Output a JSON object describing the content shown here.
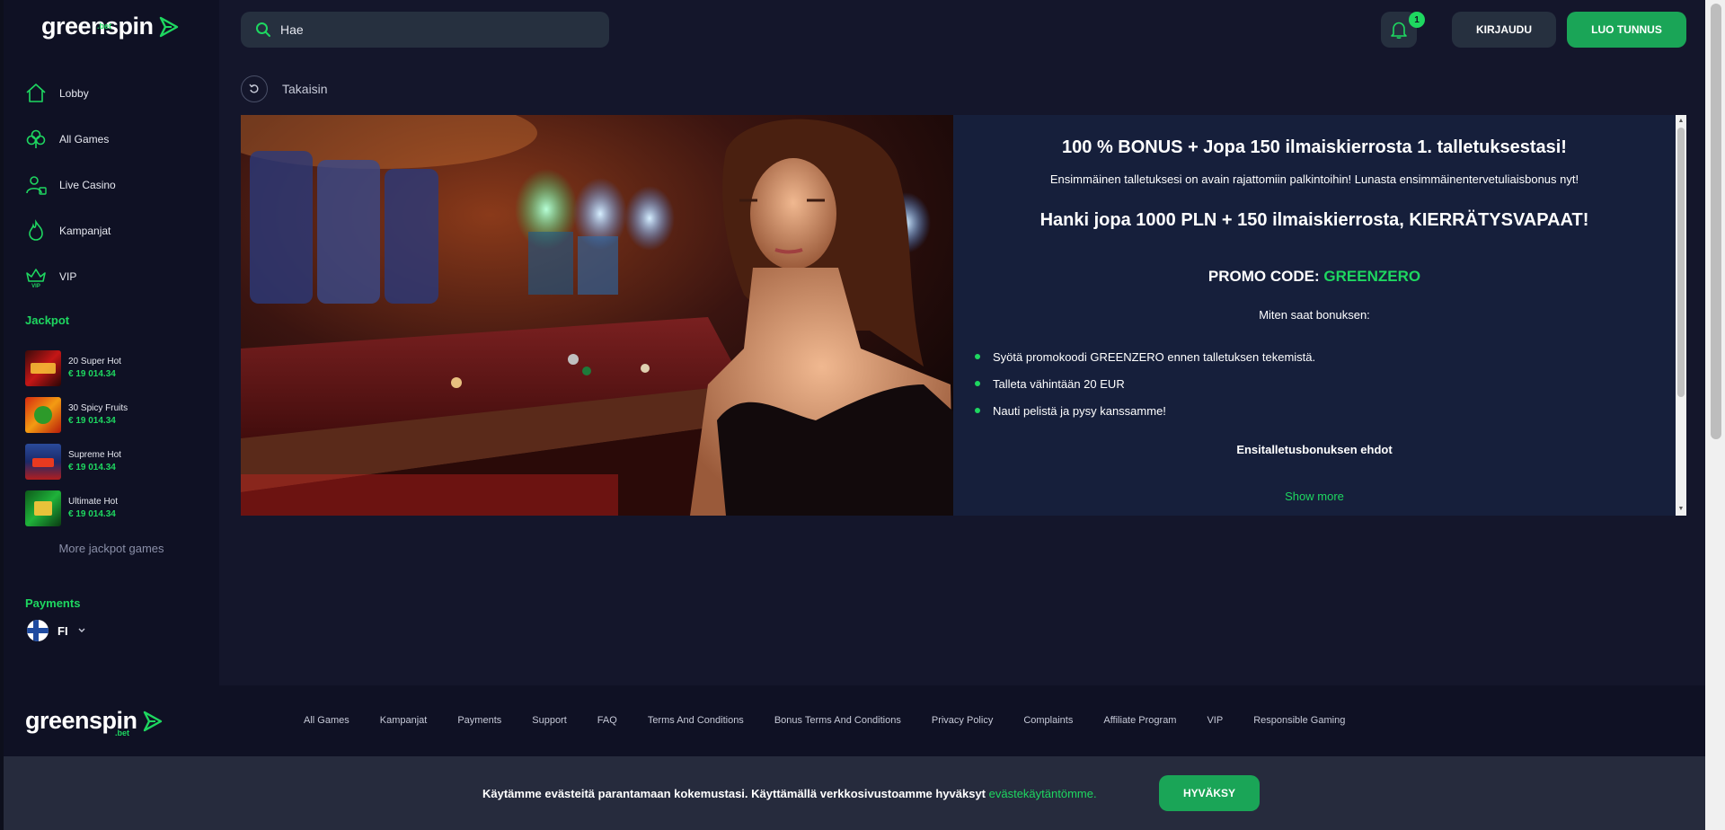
{
  "brand": {
    "name": "greenspin",
    "tld": ".bet",
    "accent": "#1ed760",
    "button_green": "#1aa557"
  },
  "header": {
    "search_placeholder": "Hae",
    "notification_count": "1",
    "login_label": "KIRJAUDU",
    "register_label": "LUO TUNNUS"
  },
  "sidebar": {
    "items": [
      {
        "label": "Lobby",
        "icon": "home-icon"
      },
      {
        "label": "All Games",
        "icon": "clover-icon"
      },
      {
        "label": "Live Casino",
        "icon": "live-dealer-icon"
      },
      {
        "label": "Kampanjat",
        "icon": "flame-icon"
      },
      {
        "label": "VIP",
        "icon": "vip-crown-icon"
      }
    ],
    "jackpot_title": "Jackpot",
    "jackpot_games": [
      {
        "name": "20 Super Hot",
        "amount": "€ 19 014.34"
      },
      {
        "name": "30 Spicy Fruits",
        "amount": "€ 19 014.34"
      },
      {
        "name": "Supreme Hot",
        "amount": "€ 19 014.34"
      },
      {
        "name": "Ultimate Hot",
        "amount": "€ 19 014.34"
      }
    ],
    "more_jackpot": "More jackpot games",
    "payments_title": "Payments",
    "language": "FI"
  },
  "back_label": "Takaisin",
  "promo": {
    "title": "100 % BONUS + Jopa 150 ilmaiskierrosta 1. talletuksestasi!",
    "subtitle": "Ensimmäinen talletuksesi on avain rajattomiin palkintoihin! Lunasta ensimmäinentervetuliaisbonus nyt!",
    "title2": "Hanki jopa 1000 PLN + 150 ilmaiskierrosta, KIERRÄTYSVAPAAT!",
    "code_label": "PROMO CODE:",
    "code": "GREENZERO",
    "how_title": "Miten saat bonuksen:",
    "steps": [
      "Syötä promokoodi GREENZERO ennen talletuksen tekemistä.",
      "Talleta vähintään 20 EUR",
      "Nauti pelistä ja pysy kanssamme!"
    ],
    "terms_title": "Ensitalletusbonuksen ehdot",
    "show_more": "Show more"
  },
  "footer": {
    "links": [
      "All Games",
      "Kampanjat",
      "Payments",
      "Support",
      "FAQ",
      "Terms And Conditions",
      "Bonus Terms And Conditions",
      "Privacy Policy",
      "Complaints",
      "Affiliate Program",
      "VIP",
      "Responsible Gaming"
    ]
  },
  "cookie": {
    "text": "Käytämme evästeitä parantamaan kokemustasi. Käyttämällä verkkosivustoamme hyväksyt ",
    "link": "evästekäytäntömme.",
    "accept": "HYVÄKSY"
  }
}
